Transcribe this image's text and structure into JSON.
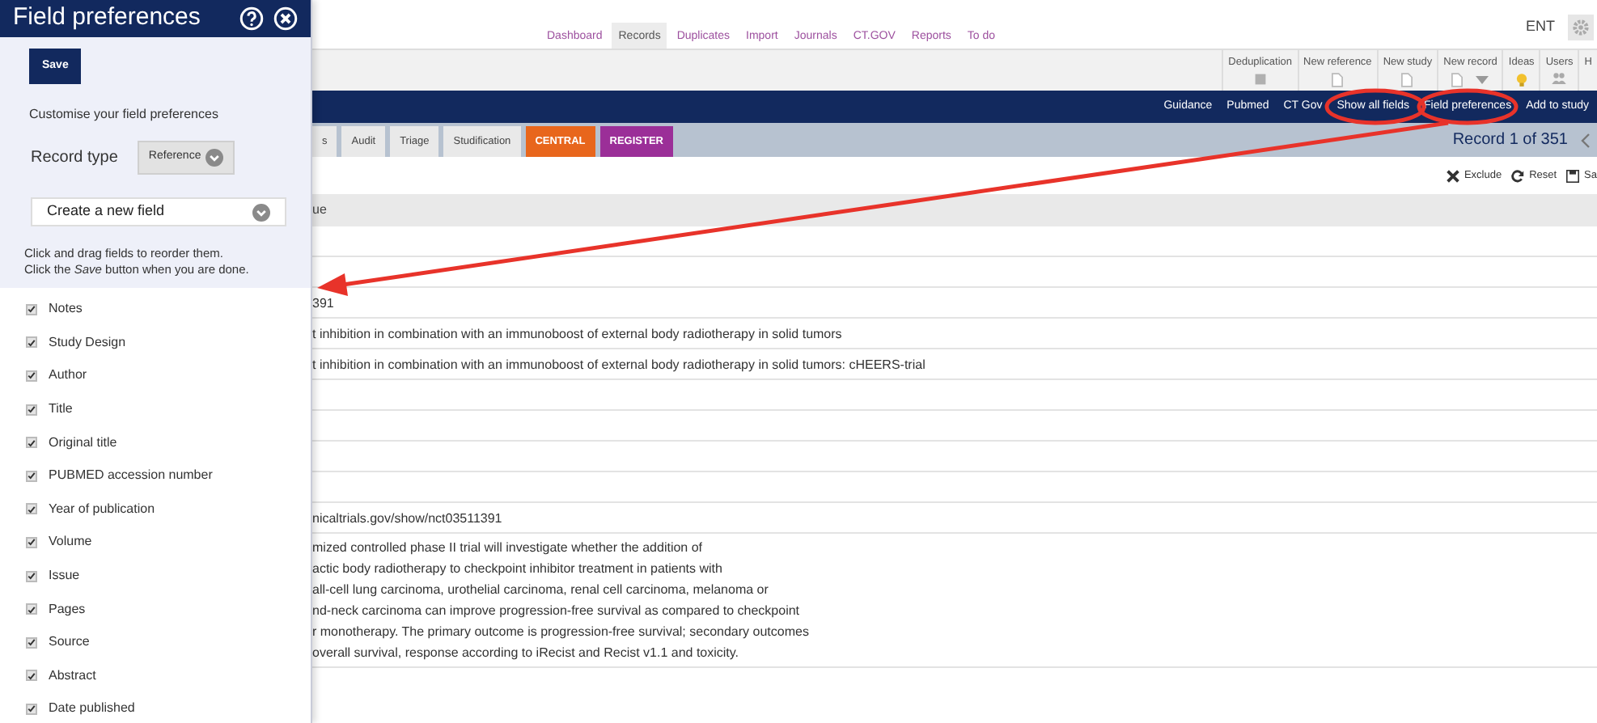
{
  "panel": {
    "title": "Field preferences",
    "save": "Save",
    "intro": "Customise your field preferences",
    "record_type_label": "Record type",
    "record_type_value": "Reference",
    "new_field": "Create a new field",
    "help": "Click and drag fields to reorder them.\nClick the *Save* button when you are done.",
    "fields": [
      {
        "label": "Notes",
        "checked": true
      },
      {
        "label": "Study Design",
        "checked": true
      },
      {
        "label": "Author",
        "checked": true
      },
      {
        "label": "Title",
        "checked": true
      },
      {
        "label": "Original title",
        "checked": true
      },
      {
        "label": "PUBMED accession number",
        "checked": true
      },
      {
        "label": "Year of publication",
        "checked": true
      },
      {
        "label": "Volume",
        "checked": true
      },
      {
        "label": "Issue",
        "checked": true
      },
      {
        "label": "Pages",
        "checked": true
      },
      {
        "label": "Source",
        "checked": true
      },
      {
        "label": "Abstract",
        "checked": true
      },
      {
        "label": "Date published",
        "checked": true
      }
    ]
  },
  "top_nav": [
    {
      "label": "Dashboard",
      "selected": false
    },
    {
      "label": "Records",
      "selected": true
    },
    {
      "label": "Duplicates",
      "selected": false
    },
    {
      "label": "Import",
      "selected": false
    },
    {
      "label": "Journals",
      "selected": false
    },
    {
      "label": "CT.GOV",
      "selected": false
    },
    {
      "label": "Reports",
      "selected": false
    },
    {
      "label": "To do",
      "selected": false
    }
  ],
  "user": "ENT",
  "toolbar": [
    {
      "label": "Deduplication",
      "kind": "dedupe"
    },
    {
      "label": "New reference",
      "kind": "doc"
    },
    {
      "label": "New study",
      "kind": "doc"
    },
    {
      "label": "New record",
      "kind": "doc-menu"
    },
    {
      "label": "Ideas",
      "kind": "idea"
    },
    {
      "label": "Users",
      "kind": "users"
    },
    {
      "label": "H",
      "kind": "none"
    }
  ],
  "action_bar": [
    "Guidance",
    "Pubmed",
    "CT Gov",
    "Show all fields",
    "Field preferences",
    "Add to study"
  ],
  "tabs": [
    {
      "label": "s"
    },
    {
      "label": "Audit"
    },
    {
      "label": "Triage"
    },
    {
      "label": "Studification"
    },
    {
      "label": "CENTRAL",
      "color": "#e8661c"
    },
    {
      "label": "REGISTER",
      "color": "#9b2f98"
    }
  ],
  "record_counter": "Record 1 of 351",
  "record_actions": [
    {
      "label": "Exclude",
      "kind": "exclude"
    },
    {
      "label": "Reset",
      "kind": "reset"
    },
    {
      "label": "Sa",
      "kind": "save"
    }
  ],
  "table": {
    "column_1": "ue",
    "rows": [
      "",
      "",
      "391",
      "t inhibition in combination with an immunoboost of external body radiotherapy in solid tumors",
      "t inhibition in combination with an immunoboost of external body radiotherapy in solid tumors: cHEERS-trial",
      "",
      "",
      "",
      "",
      "nicaltrials.gov/show/nct03511391",
      "mized controlled phase II trial will investigate whether the addition of\nactic body radiotherapy to checkpoint inhibitor treatment in patients with\nall-cell lung carcinoma, urothelial carcinoma, renal cell carcinoma, melanoma or\nnd-neck carcinoma can improve progression-free survival as compared to checkpoint\nr monotherapy. The primary outcome is progression-free survival; secondary outcomes\noverall survival, response according to iRecist and Recist v1.1 and toxicity."
    ]
  }
}
